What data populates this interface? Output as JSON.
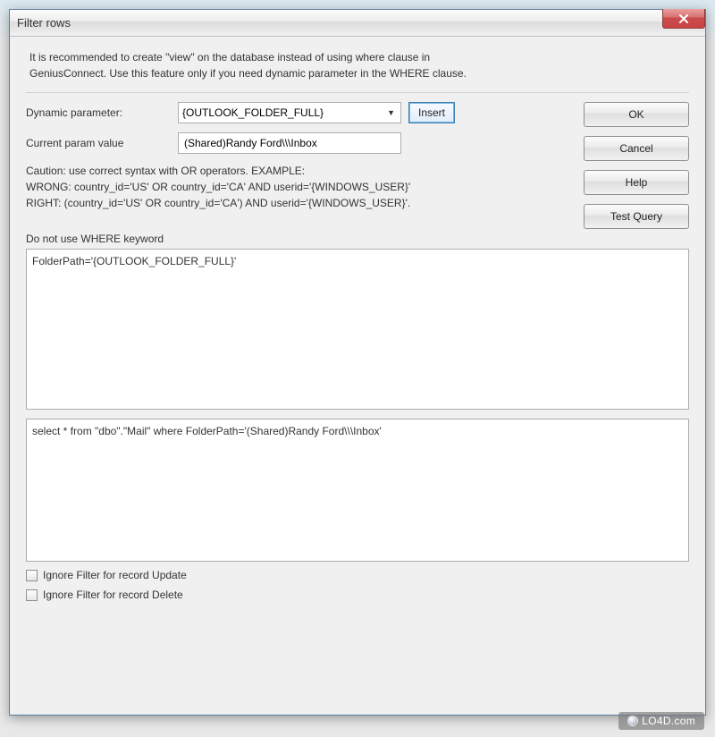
{
  "window": {
    "title": "Filter rows"
  },
  "recommend": {
    "line1": "It is recommended to create \"view\" on the database instead of using where clause in",
    "line2": "GeniusConnect. Use this feature only if you need dynamic parameter in the WHERE clause."
  },
  "form": {
    "dynamic_label": "Dynamic parameter:",
    "dynamic_value": "{OUTLOOK_FOLDER_FULL}",
    "insert_label": "Insert",
    "current_label": "Current param value",
    "current_value": "(Shared)Randy Ford\\\\\\Inbox"
  },
  "buttons": {
    "ok": "OK",
    "cancel": "Cancel",
    "help": "Help",
    "test_query": "Test Query"
  },
  "caution": {
    "line1": "Caution: use correct syntax with OR operators. EXAMPLE:",
    "line2": "WRONG: country_id='US' OR country_id='CA' AND userid='{WINDOWS_USER}'",
    "line3": "RIGHT: (country_id='US' OR country_id='CA') AND userid='{WINDOWS_USER}'."
  },
  "no_where": "Do not use WHERE keyword",
  "filter_text": "FolderPath='{OUTLOOK_FOLDER_FULL}'",
  "query_text": "select * from \"dbo\".\"Mail\" where FolderPath='(Shared)Randy Ford\\\\\\Inbox'",
  "checks": {
    "update": "Ignore Filter for record Update",
    "delete": "Ignore Filter for record Delete"
  },
  "watermark": "LO4D.com"
}
